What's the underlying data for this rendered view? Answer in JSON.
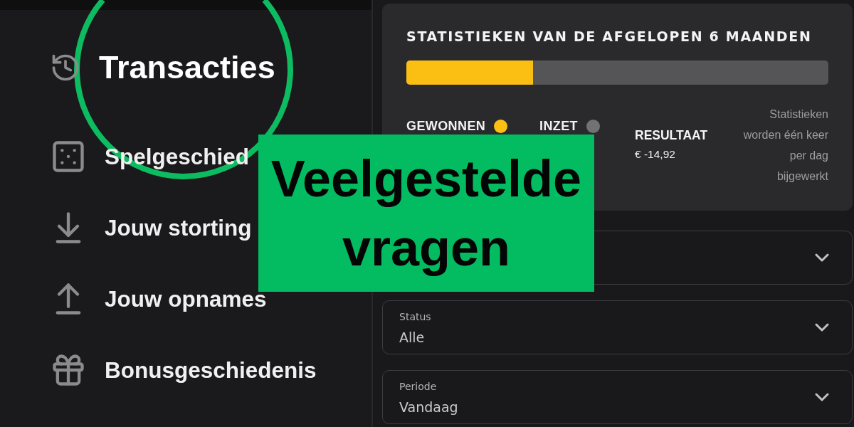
{
  "sidebar": {
    "items": [
      {
        "label": "Transacties",
        "selected": true
      },
      {
        "label": "Spelgeschied",
        "selected": false
      },
      {
        "label": "Jouw storting",
        "selected": false
      },
      {
        "label": "Jouw opnames",
        "selected": false
      },
      {
        "label": "Bonusgeschiedenis",
        "selected": false
      }
    ]
  },
  "stats": {
    "title": "STATISTIEKEN VAN DE AFGELOPEN 6 MAANDEN",
    "level": 0.3,
    "legend": [
      {
        "label": "GEWONNEN",
        "color": "#fbbf14"
      },
      {
        "label": "INZET",
        "color": "#727174"
      }
    ],
    "result": {
      "label": "RESULTAAT",
      "value": "€ -14,92"
    },
    "note": "Statistieken worden één keer per dag bijgewerkt"
  },
  "filters": [
    {
      "label": "Status",
      "value": "Alle"
    },
    {
      "label": "Periode",
      "value": "Vandaag"
    }
  ],
  "banner": {
    "text": "Veelgestelde vragen"
  }
}
